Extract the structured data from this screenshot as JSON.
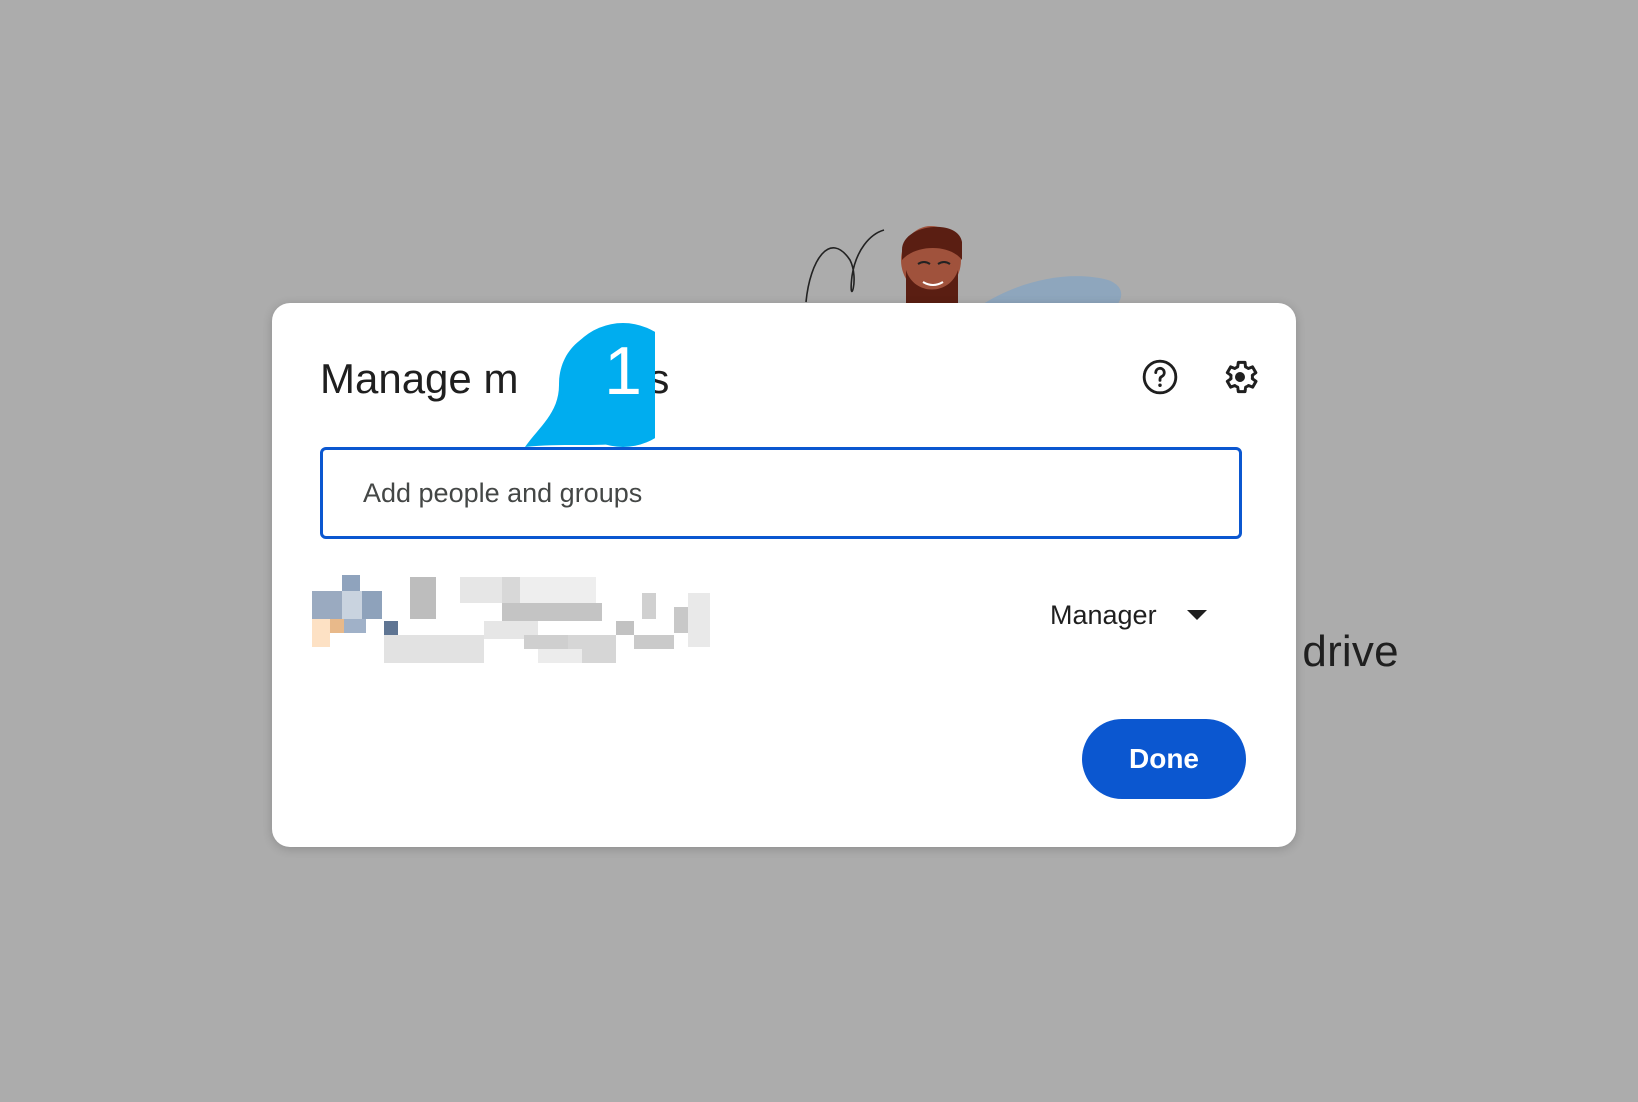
{
  "background": {
    "partial_text": "l drive"
  },
  "dialog": {
    "title": "Manage m",
    "title_tail": "rs",
    "help_icon": "help-circle-icon",
    "settings_icon": "gear-icon",
    "search": {
      "placeholder": "Add people and groups",
      "value": ""
    },
    "member": {
      "role": "Manager"
    },
    "done_label": "Done"
  },
  "callout": {
    "number": "1",
    "color": "#00adef"
  },
  "colors": {
    "accent": "#0b57d0",
    "overlay": "#acacac"
  }
}
